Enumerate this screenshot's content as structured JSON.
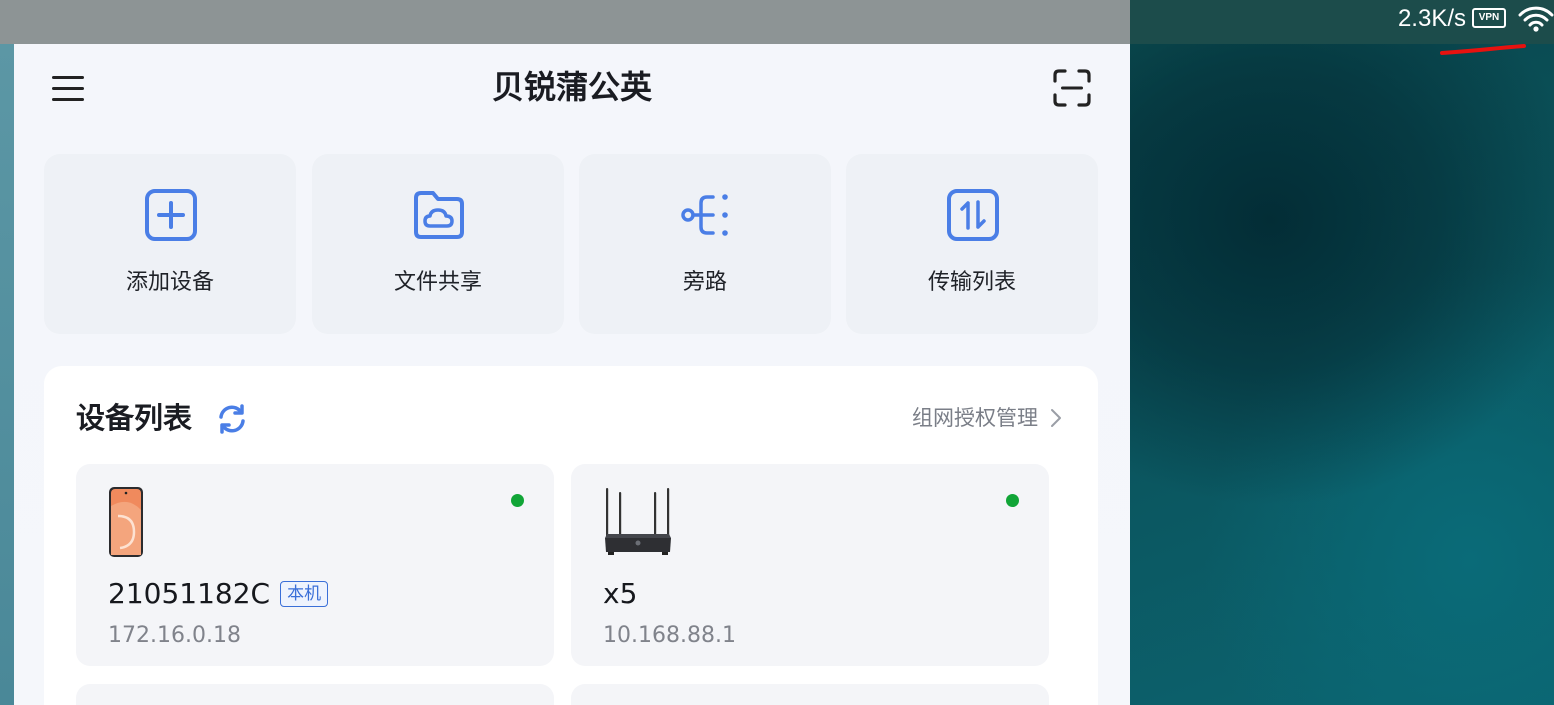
{
  "status_bar": {
    "net_speed": "2.3K/s",
    "vpn_label": "VPN",
    "icons": [
      "vpn-icon",
      "wifi-icon"
    ]
  },
  "app": {
    "title": "贝锐蒲公英",
    "header_icons": [
      "menu-icon",
      "scan-icon"
    ],
    "quick_actions": [
      {
        "label": "添加设备",
        "icon": "add-square-icon"
      },
      {
        "label": "文件共享",
        "icon": "cloud-folder-icon"
      },
      {
        "label": "旁路",
        "icon": "bypass-icon"
      },
      {
        "label": "传输列表",
        "icon": "transfer-icon"
      }
    ],
    "device_list": {
      "title": "设备列表",
      "manage_link": "组网授权管理",
      "devices": [
        {
          "name": "21051182C",
          "badge": "本机",
          "ip": "172.16.0.18",
          "status": "online",
          "icon": "phone-icon"
        },
        {
          "name": "x5",
          "ip": "10.168.88.1",
          "status": "online",
          "icon": "router-icon"
        }
      ]
    }
  },
  "colors": {
    "accent": "#3a6fd8",
    "online": "#11a537",
    "icon_blue": "#4a7ee6"
  }
}
